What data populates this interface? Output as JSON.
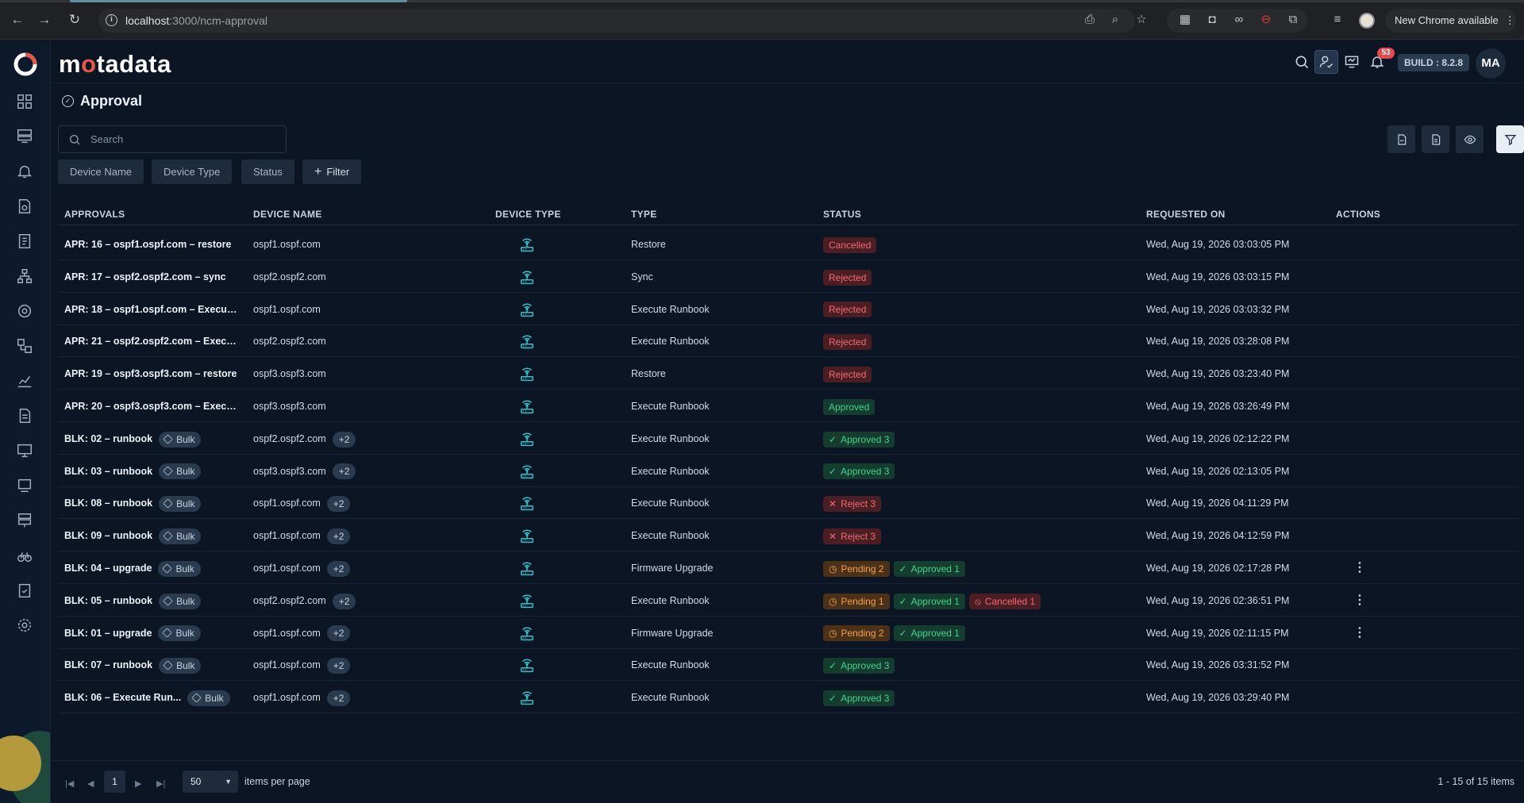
{
  "browser": {
    "url_host": "localhost",
    "url_path": ":3000/ncm-approval",
    "new_chrome_label": "New Chrome available",
    "menu_glyph": "⋮"
  },
  "header": {
    "brand_pre": "m",
    "brand_dot": "o",
    "brand_post": "tadata",
    "notification_count": "53",
    "build_label": "BUILD : 8.2.8",
    "avatar_initials": "MA"
  },
  "page": {
    "title": "Approval"
  },
  "search": {
    "placeholder": "Search"
  },
  "filters": {
    "device_name": "Device Name",
    "device_type": "Device Type",
    "status": "Status",
    "add_filter": "Filter"
  },
  "columns": {
    "approvals": "APPROVALS",
    "device_name": "DEVICE NAME",
    "device_type": "DEVICE TYPE",
    "type": "TYPE",
    "status": "STATUS",
    "requested_on": "REQUESTED ON",
    "actions": "ACTIONS"
  },
  "rows": [
    {
      "approval": "APR: 16 – ospf1.ospf.com – restore",
      "bulk": "",
      "device": "ospf1.ospf.com",
      "more": "",
      "type": "Restore",
      "statuses": [
        {
          "kind": "cancelled",
          "label": "Cancelled",
          "icon": ""
        }
      ],
      "requested": "Wed, Aug 19, 2026 03:03:05 PM",
      "actions": false
    },
    {
      "approval": "APR: 17 – ospf2.ospf2.com – sync",
      "bulk": "",
      "device": "ospf2.ospf2.com",
      "more": "",
      "type": "Sync",
      "statuses": [
        {
          "kind": "rejected",
          "label": "Rejected",
          "icon": ""
        }
      ],
      "requested": "Wed, Aug 19, 2026 03:03:15 PM",
      "actions": false
    },
    {
      "approval": "APR: 18 – ospf1.ospf.com – Execute ...",
      "bulk": "",
      "device": "ospf1.ospf.com",
      "more": "",
      "type": "Execute Runbook",
      "statuses": [
        {
          "kind": "rejected",
          "label": "Rejected",
          "icon": ""
        }
      ],
      "requested": "Wed, Aug 19, 2026 03:03:32 PM",
      "actions": false
    },
    {
      "approval": "APR: 21 – ospf2.ospf2.com – Execut...",
      "bulk": "",
      "device": "ospf2.ospf2.com",
      "more": "",
      "type": "Execute Runbook",
      "statuses": [
        {
          "kind": "rejected",
          "label": "Rejected",
          "icon": ""
        }
      ],
      "requested": "Wed, Aug 19, 2026 03:28:08 PM",
      "actions": false
    },
    {
      "approval": "APR: 19 – ospf3.ospf3.com – restore",
      "bulk": "",
      "device": "ospf3.ospf3.com",
      "more": "",
      "type": "Restore",
      "statuses": [
        {
          "kind": "rejected",
          "label": "Rejected",
          "icon": ""
        }
      ],
      "requested": "Wed, Aug 19, 2026 03:23:40 PM",
      "actions": false
    },
    {
      "approval": "APR: 20 – ospf3.ospf3.com – Execut...",
      "bulk": "",
      "device": "ospf3.ospf3.com",
      "more": "",
      "type": "Execute Runbook",
      "statuses": [
        {
          "kind": "approved",
          "label": "Approved",
          "icon": ""
        }
      ],
      "requested": "Wed, Aug 19, 2026 03:26:49 PM",
      "actions": false
    },
    {
      "approval": "BLK: 02 – runbook",
      "bulk": "Bulk",
      "device": "ospf2.ospf2.com",
      "more": "+2",
      "type": "Execute Runbook",
      "statuses": [
        {
          "kind": "approved",
          "label": "Approved 3",
          "icon": "✓"
        }
      ],
      "requested": "Wed, Aug 19, 2026 02:12:22 PM",
      "actions": false
    },
    {
      "approval": "BLK: 03 – runbook",
      "bulk": "Bulk",
      "device": "ospf3.ospf3.com",
      "more": "+2",
      "type": "Execute Runbook",
      "statuses": [
        {
          "kind": "approved",
          "label": "Approved 3",
          "icon": "✓"
        }
      ],
      "requested": "Wed, Aug 19, 2026 02:13:05 PM",
      "actions": false
    },
    {
      "approval": "BLK: 08 – runbook",
      "bulk": "Bulk",
      "device": "ospf1.ospf.com",
      "more": "+2",
      "type": "Execute Runbook",
      "statuses": [
        {
          "kind": "rejected",
          "label": "Reject 3",
          "icon": "✕"
        }
      ],
      "requested": "Wed, Aug 19, 2026 04:11:29 PM",
      "actions": false
    },
    {
      "approval": "BLK: 09 – runbook",
      "bulk": "Bulk",
      "device": "ospf1.ospf.com",
      "more": "+2",
      "type": "Execute Runbook",
      "statuses": [
        {
          "kind": "rejected",
          "label": "Reject 3",
          "icon": "✕"
        }
      ],
      "requested": "Wed, Aug 19, 2026 04:12:59 PM",
      "actions": false
    },
    {
      "approval": "BLK: 04 – upgrade",
      "bulk": "Bulk",
      "device": "ospf1.ospf.com",
      "more": "+2",
      "type": "Firmware Upgrade",
      "statuses": [
        {
          "kind": "pending",
          "label": "Pending 2",
          "icon": "◷"
        },
        {
          "kind": "approved",
          "label": "Approved 1",
          "icon": "✓"
        }
      ],
      "requested": "Wed, Aug 19, 2026 02:17:28 PM",
      "actions": true
    },
    {
      "approval": "BLK: 05 – runbook",
      "bulk": "Bulk",
      "device": "ospf2.ospf2.com",
      "more": "+2",
      "type": "Execute Runbook",
      "statuses": [
        {
          "kind": "pending",
          "label": "Pending 1",
          "icon": "◷"
        },
        {
          "kind": "approved",
          "label": "Approved 1",
          "icon": "✓"
        },
        {
          "kind": "cancelled",
          "label": "Cancelled 1",
          "icon": "⦸"
        }
      ],
      "requested": "Wed, Aug 19, 2026 02:36:51 PM",
      "actions": true
    },
    {
      "approval": "BLK: 01 – upgrade",
      "bulk": "Bulk",
      "device": "ospf1.ospf.com",
      "more": "+2",
      "type": "Firmware Upgrade",
      "statuses": [
        {
          "kind": "pending",
          "label": "Pending 2",
          "icon": "◷"
        },
        {
          "kind": "approved",
          "label": "Approved 1",
          "icon": "✓"
        }
      ],
      "requested": "Wed, Aug 19, 2026 02:11:15 PM",
      "actions": true
    },
    {
      "approval": "BLK: 07 – runbook",
      "bulk": "Bulk",
      "device": "ospf1.ospf.com",
      "more": "+2",
      "type": "Execute Runbook",
      "statuses": [
        {
          "kind": "approved",
          "label": "Approved 3",
          "icon": "✓"
        }
      ],
      "requested": "Wed, Aug 19, 2026 03:31:52 PM",
      "actions": false
    },
    {
      "approval": "BLK: 06 – Execute Run...",
      "bulk": "Bulk",
      "device": "ospf1.ospf.com",
      "more": "+2",
      "type": "Execute Runbook",
      "statuses": [
        {
          "kind": "approved",
          "label": "Approved 3",
          "icon": "✓"
        }
      ],
      "requested": "Wed, Aug 19, 2026 03:29:40 PM",
      "actions": false
    }
  ],
  "pager": {
    "current_page": "1",
    "page_size": "50",
    "items_per_page_label": "items per page",
    "range_label": "1 - 15 of 15 items"
  },
  "icons": {
    "device_type": "wireless-router-icon",
    "row_menu": "kebab-icon"
  },
  "colors": {
    "accent_teal": "#2ec4c9",
    "brand_red": "#e8584a",
    "approved": "#3fd48a",
    "rejected": "#f16b74",
    "pending": "#f5a04a"
  }
}
